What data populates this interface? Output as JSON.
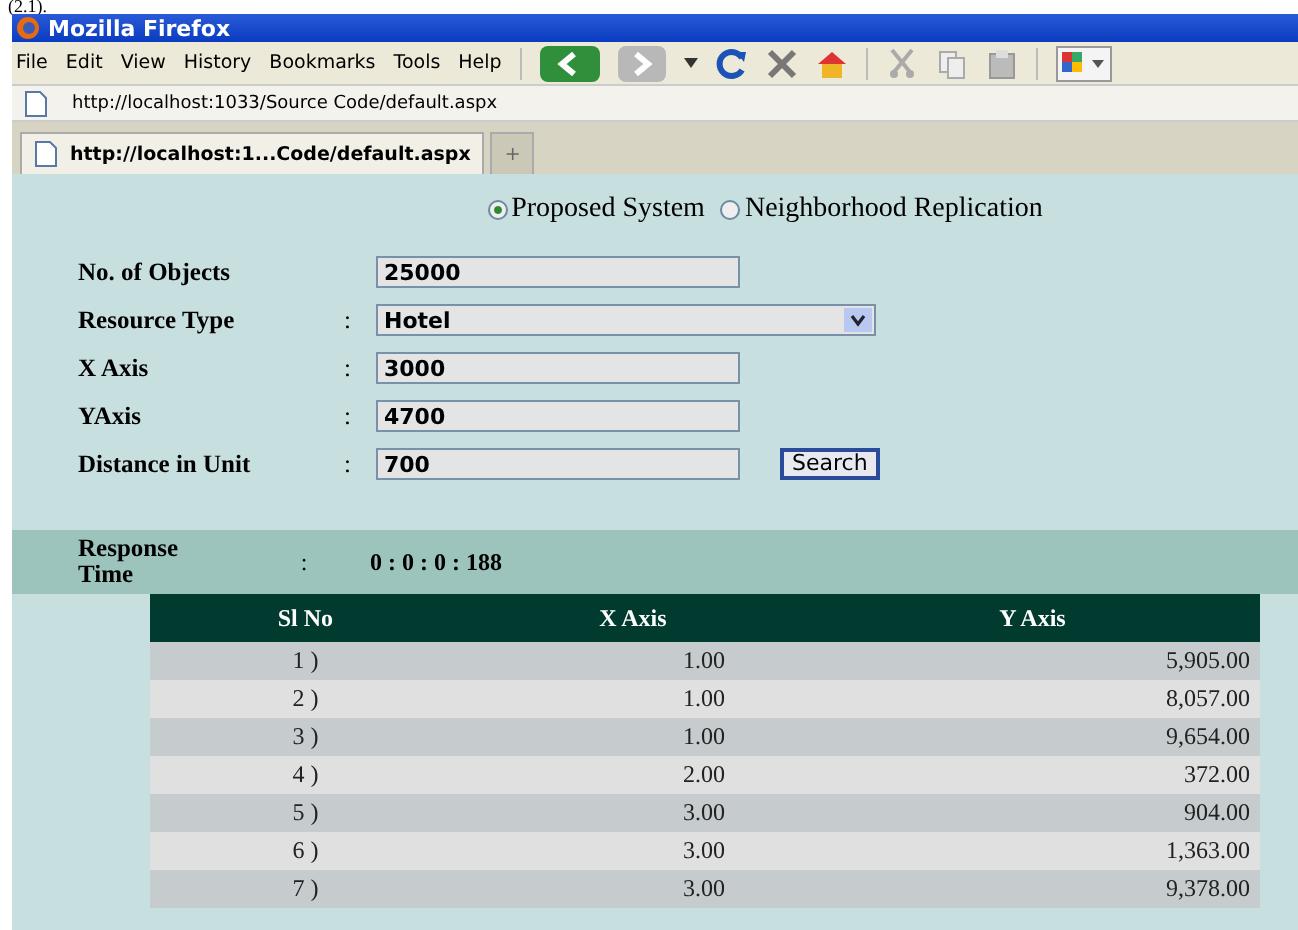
{
  "caption": "(2.1).",
  "window": {
    "title": "Mozilla Firefox"
  },
  "menu": [
    "File",
    "Edit",
    "View",
    "History",
    "Bookmarks",
    "Tools",
    "Help"
  ],
  "address_bar": {
    "value": "http://localhost:1033/Source Code/default.aspx"
  },
  "tabs": [
    {
      "label": "http://localhost:1...Code/default.aspx",
      "selected": true
    },
    {
      "label": "+",
      "selected": false
    }
  ],
  "modes": [
    {
      "label": "Proposed System",
      "selected": true
    },
    {
      "label": "Neighborhood Replication",
      "selected": false
    }
  ],
  "fields": [
    {
      "kind": "text",
      "label": "No. of Objects",
      "value": "25000"
    },
    {
      "kind": "select",
      "label": "Resource Type",
      "colon": ":",
      "value": "Hotel"
    },
    {
      "kind": "text",
      "label": "X Axis",
      "colon": ":",
      "value": "3000"
    },
    {
      "kind": "text",
      "label": "YAxis",
      "colon": ":",
      "value": "4700"
    },
    {
      "kind": "text",
      "label": "Distance in Unit",
      "colon": ":",
      "value": "700",
      "button": "Search"
    }
  ],
  "response": {
    "label": "Response Time",
    "colon": ":",
    "value": "0 : 0 : 0 : 188"
  },
  "table": {
    "columns": [
      "Sl No",
      "X Axis",
      "Y Axis"
    ],
    "rows": [
      [
        "1 )",
        "1.00",
        "5,905.00"
      ],
      [
        "2 )",
        "1.00",
        "8,057.00"
      ],
      [
        "3 )",
        "1.00",
        "9,654.00"
      ],
      [
        "4 )",
        "2.00",
        "372.00"
      ],
      [
        "5 )",
        "3.00",
        "904.00"
      ],
      [
        "6 )",
        "3.00",
        "1,363.00"
      ],
      [
        "7 )",
        "3.00",
        "9,378.00"
      ]
    ]
  }
}
